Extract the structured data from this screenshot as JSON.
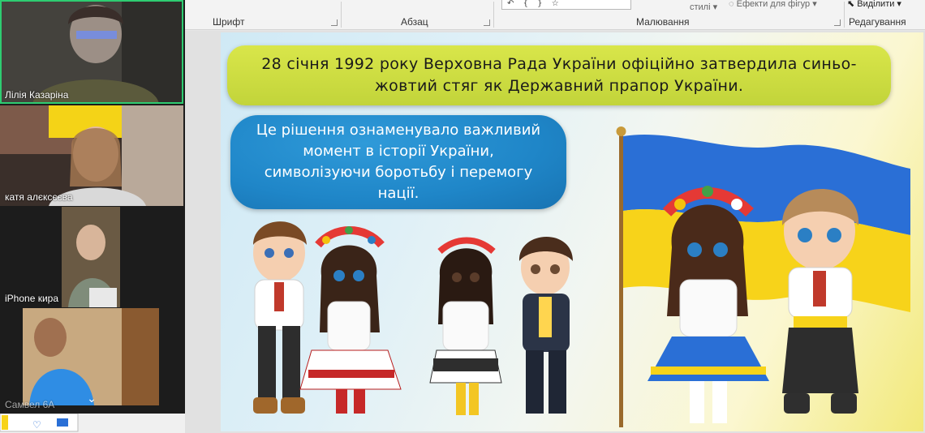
{
  "ribbon": {
    "groups": [
      {
        "label": "Шрифт"
      },
      {
        "label": "Абзац"
      },
      {
        "label": "Малювання"
      },
      {
        "label": "Редагування"
      }
    ],
    "styles_label": "стилі",
    "shape_effects_label": "Ефекти для фігур",
    "select_label": "Виділити"
  },
  "slide": {
    "headline": "28 січня 1992 року Верховна Рада України офіційно затвердила синьо-жовтий стяг як Державний прапор України.",
    "bubble_text": "Це рішення ознаменувало важливий момент в історії України, символізуючи боротьбу і перемогу нації."
  },
  "participants": [
    {
      "name": "Лілія Казаріна",
      "active": true
    },
    {
      "name": "катя алєксєєва",
      "active": false
    },
    {
      "name": "iPhone кира",
      "active": false
    },
    {
      "name": "Самвел 6А",
      "active": false
    }
  ],
  "colors": {
    "flag_blue": "#2a6fd6",
    "flag_yellow": "#f7d31a",
    "banner_green": "#cdd93f",
    "bubble_blue": "#2390d1",
    "active_speaker": "#2ecc71"
  }
}
